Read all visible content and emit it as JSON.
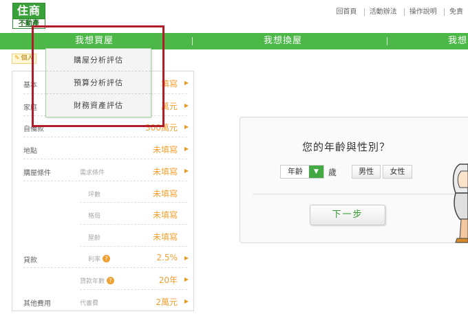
{
  "logo": {
    "line1": "住商",
    "line2": "不動產"
  },
  "top_links": [
    "回首頁",
    "活動辦法",
    "操作說明",
    "免責"
  ],
  "nav": {
    "items": [
      "我想買屋",
      "我想換屋",
      "我想"
    ]
  },
  "personal_tag": {
    "label": "個人"
  },
  "dropdown": {
    "items": [
      "購屋分析評估",
      "預算分析評估",
      "財務資產評估"
    ]
  },
  "form_rows": [
    {
      "label": "基本",
      "sub": "",
      "value": "填寫"
    },
    {
      "label": "家庭",
      "sub": "",
      "value": "萬元"
    },
    {
      "label": "自備款",
      "sub": "",
      "value": "300萬元"
    },
    {
      "label": "地點",
      "sub": "",
      "value": "未填寫"
    },
    {
      "label": "購屋條件",
      "sub": "需求條件",
      "value": "未填寫"
    },
    {
      "label": "",
      "sub": "坪數",
      "value": "未填寫"
    },
    {
      "label": "",
      "sub": "格局",
      "value": "未填寫"
    },
    {
      "label": "",
      "sub": "屋齡",
      "value": "未填寫"
    },
    {
      "label": "貸款",
      "sub": "利率",
      "value": "2.5%"
    },
    {
      "label": "",
      "sub": "貸款年數",
      "value": "20年"
    },
    {
      "label": "其他費用",
      "sub": "代書費",
      "value": "2萬元"
    }
  ],
  "question": {
    "title": "您的年齡與性別？",
    "age_placeholder": "年齡",
    "age_unit": "歲",
    "gender_male": "男性",
    "gender_female": "女性",
    "next_label": "下一步"
  },
  "colors": {
    "nav_green": "#4cb848",
    "accent_orange": "#f0a030",
    "highlight_red": "#b01c2a"
  }
}
